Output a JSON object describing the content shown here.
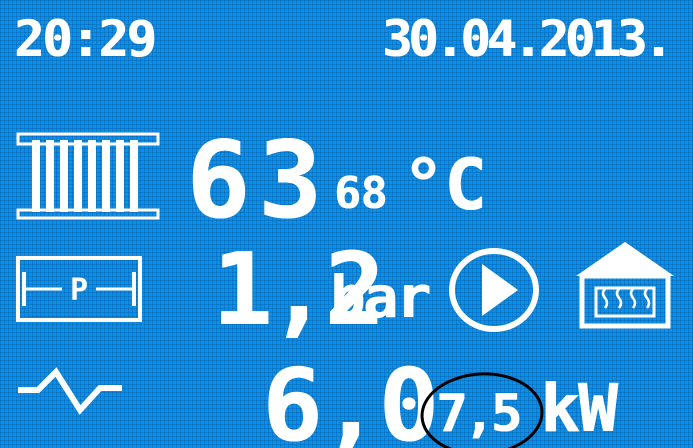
{
  "status_bar": {
    "time": "20:29",
    "date": "30.04.2013."
  },
  "temperature": {
    "actual": "63",
    "setpoint": "68",
    "unit": "°C"
  },
  "pressure": {
    "value": "1,2",
    "unit": "bar",
    "sensor_label": "P"
  },
  "power": {
    "value": "6,0",
    "max": "7,5",
    "unit": "kW"
  },
  "icons": {
    "radiator": "radiator-icon",
    "pressure": "pressure-sensor-icon",
    "pump": "pump-play-icon",
    "house": "house-heating-icon",
    "wave": "wave-icon"
  },
  "colors": {
    "background": "#0a90ea",
    "foreground": "#ffffff",
    "annotation": "#000000"
  }
}
